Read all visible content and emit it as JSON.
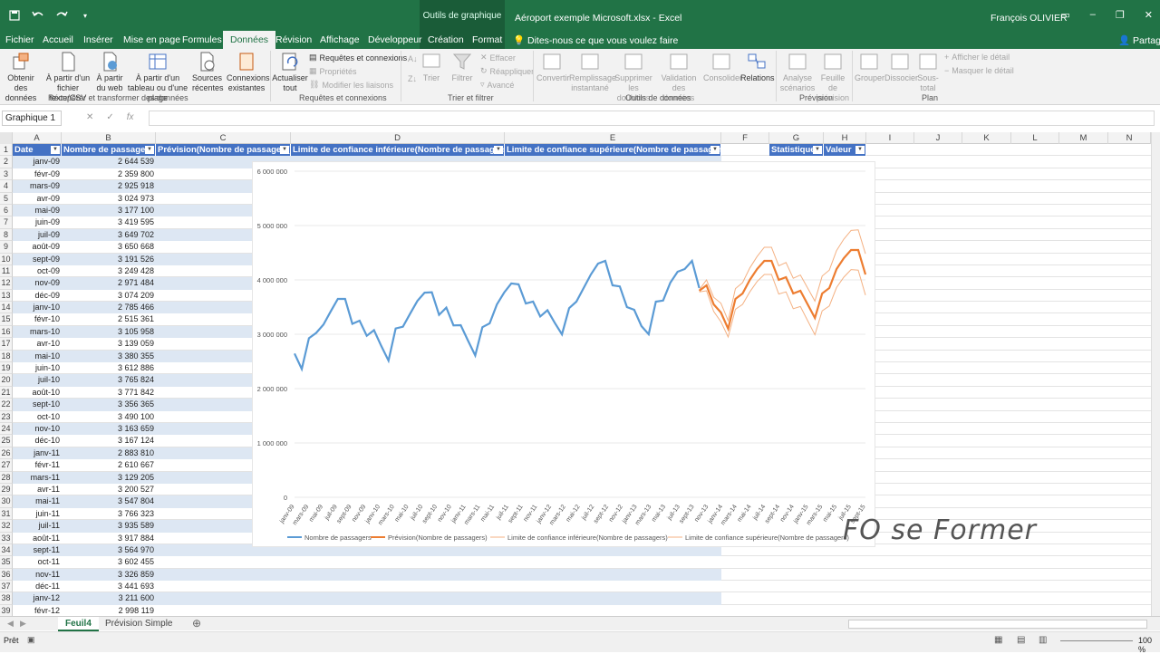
{
  "titlebar": {
    "context_tools": "Outils de graphique",
    "doc_title": "Aéroport exemple Microsoft.xlsx - Excel",
    "user": "François OLIVIER"
  },
  "tabs": [
    {
      "id": "fichier",
      "label": "Fichier"
    },
    {
      "id": "accueil",
      "label": "Accueil"
    },
    {
      "id": "inserer",
      "label": "Insérer"
    },
    {
      "id": "mise-en-page",
      "label": "Mise en page"
    },
    {
      "id": "formules",
      "label": "Formules"
    },
    {
      "id": "donnees",
      "label": "Données"
    },
    {
      "id": "revision",
      "label": "Révision"
    },
    {
      "id": "affichage",
      "label": "Affichage"
    },
    {
      "id": "developpeur",
      "label": "Développeur"
    },
    {
      "id": "creation",
      "label": "Création"
    },
    {
      "id": "format",
      "label": "Format"
    }
  ],
  "tellme": "Dites-nous ce que vous voulez faire",
  "share": "Partager",
  "ribbon": {
    "obtenir": "Obtenir des données",
    "texte_csv": "À partir d'un fichier texte/CSV",
    "web": "À partir du web",
    "tableau": "À partir d'un tableau ou d'une plage",
    "sources": "Sources récentes",
    "connexions": "Connexions existantes",
    "group_recuperer": "Récupérer et transformer des données",
    "actualiser": "Actualiser tout",
    "req_conn": "Requêtes et connexions",
    "proprietes": "Propriétés",
    "modifier_liaisons": "Modifier les liaisons",
    "group_req": "Requêtes et connexions",
    "trier": "Trier",
    "filtrer": "Filtrer",
    "effacer": "Effacer",
    "reappliquer": "Réappliquer",
    "avance": "Avancé",
    "group_trier": "Trier et filtrer",
    "convertir": "Convertir",
    "remplissage": "Remplissage instantané",
    "doublons": "Supprimer les doublons",
    "validation": "Validation des données",
    "consolider": "Consolider",
    "relations": "Relations",
    "group_outils": "Outils de données",
    "analyse": "Analyse scénarios",
    "feuille_prev": "Feuille de prévision",
    "group_prev": "Prévision",
    "grouper": "Grouper",
    "dissocier": "Dissocier",
    "sous_total": "Sous-total",
    "afficher_detail": "Afficher le détail",
    "masquer_detail": "Masquer le détail",
    "group_plan": "Plan"
  },
  "formula": {
    "namebox": "Graphique 1",
    "value": ""
  },
  "columns": [
    "A",
    "B",
    "C",
    "D",
    "E",
    "F",
    "G",
    "H",
    "I",
    "J",
    "K",
    "L",
    "M",
    "N"
  ],
  "headers": {
    "A": "Date",
    "B": "Nombre de passagers",
    "C": "Prévision(Nombre de passagers)",
    "D": "Limite de confiance inférieure(Nombre de passagers)",
    "E": "Limite de confiance supérieure(Nombre de passagers)",
    "G": "Statistique",
    "H": "Valeur"
  },
  "rows": [
    [
      "janv-09",
      "2 644 539"
    ],
    [
      "févr-09",
      "2 359 800"
    ],
    [
      "mars-09",
      "2 925 918"
    ],
    [
      "avr-09",
      "3 024 973"
    ],
    [
      "mai-09",
      "3 177 100"
    ],
    [
      "juin-09",
      "3 419 595"
    ],
    [
      "juil-09",
      "3 649 702"
    ],
    [
      "août-09",
      "3 650 668"
    ],
    [
      "sept-09",
      "3 191 526"
    ],
    [
      "oct-09",
      "3 249 428"
    ],
    [
      "nov-09",
      "2 971 484"
    ],
    [
      "déc-09",
      "3 074 209"
    ],
    [
      "janv-10",
      "2 785 466"
    ],
    [
      "févr-10",
      "2 515 361"
    ],
    [
      "mars-10",
      "3 105 958"
    ],
    [
      "avr-10",
      "3 139 059"
    ],
    [
      "mai-10",
      "3 380 355"
    ],
    [
      "juin-10",
      "3 612 886"
    ],
    [
      "juil-10",
      "3 765 824"
    ],
    [
      "août-10",
      "3 771 842"
    ],
    [
      "sept-10",
      "3 356 365"
    ],
    [
      "oct-10",
      "3 490 100"
    ],
    [
      "nov-10",
      "3 163 659"
    ],
    [
      "déc-10",
      "3 167 124"
    ],
    [
      "janv-11",
      "2 883 810"
    ],
    [
      "févr-11",
      "2 610 667"
    ],
    [
      "mars-11",
      "3 129 205"
    ],
    [
      "avr-11",
      "3 200 527"
    ],
    [
      "mai-11",
      "3 547 804"
    ],
    [
      "juin-11",
      "3 766 323"
    ],
    [
      "juil-11",
      "3 935 589"
    ],
    [
      "août-11",
      "3 917 884"
    ],
    [
      "sept-11",
      "3 564 970"
    ],
    [
      "oct-11",
      "3 602 455"
    ],
    [
      "nov-11",
      "3 326 859"
    ],
    [
      "déc-11",
      "3 441 693"
    ],
    [
      "janv-12",
      "3 211 600"
    ],
    [
      "févr-12",
      "2 998 119"
    ]
  ],
  "sheets": [
    {
      "label": "Feuil4",
      "active": true
    },
    {
      "label": "Prévision Simple",
      "active": false
    }
  ],
  "status": {
    "ready": "Prêt",
    "zoom": "100 %"
  },
  "watermark": "FO se Former",
  "chart_data": {
    "type": "line",
    "ylim": [
      0,
      6000000
    ],
    "yticks": [
      "0",
      "1 000 000",
      "2 000 000",
      "3 000 000",
      "4 000 000",
      "5 000 000",
      "6 000 000"
    ],
    "xticks": [
      "janv-09",
      "mars-09",
      "mai-09",
      "juil-09",
      "sept-09",
      "nov-09",
      "janv-10",
      "mars-10",
      "mai-10",
      "juil-10",
      "sept-10",
      "nov-10",
      "janv-11",
      "mars-11",
      "mai-11",
      "juil-11",
      "sept-11",
      "nov-11",
      "janv-12",
      "mars-12",
      "mai-12",
      "juil-12",
      "sept-12",
      "nov-12",
      "janv-13",
      "mars-13",
      "mai-13",
      "juil-13",
      "sept-13",
      "nov-13",
      "janv-14",
      "mars-14",
      "mai-14",
      "juil-14",
      "sept-14",
      "nov-14",
      "janv-15",
      "mars-15",
      "mai-15",
      "juil-15",
      "sept-15"
    ],
    "legend": [
      "Nombre de passagers",
      "Prévision(Nombre de passagers)",
      "Limite de confiance inférieure(Nombre de passagers)",
      "Limite de confiance supérieure(Nombre de passagers)"
    ],
    "colors": [
      "#5b9bd5",
      "#ed7d31",
      "#f4b183",
      "#f4b183"
    ],
    "actual": [
      2644539,
      2359800,
      2925918,
      3024973,
      3177100,
      3419595,
      3649702,
      3650668,
      3191526,
      3249428,
      2971484,
      3074209,
      2785466,
      2515361,
      3105958,
      3139059,
      3380355,
      3612886,
      3765824,
      3771842,
      3356365,
      3490100,
      3163659,
      3167124,
      2883810,
      2610667,
      3129205,
      3200527,
      3547804,
      3766323,
      3935589,
      3917884,
      3564970,
      3602455,
      3326859,
      3441693,
      3211600,
      2998119,
      3480000,
      3600000,
      3850000,
      4100000,
      4300000,
      4350000,
      3900000,
      3880000,
      3500000,
      3450000,
      3150000,
      3000000,
      3600000,
      3620000,
      3950000,
      4150000,
      4200000,
      4350000,
      3850000
    ],
    "forecast": [
      3800000,
      3900000,
      3550000,
      3400000,
      3100000,
      3650000,
      3750000,
      4000000,
      4200000,
      4350000,
      4350000,
      4000000,
      4050000,
      3750000,
      3800000,
      3550000,
      3300000,
      3750000,
      3850000,
      4200000,
      4400000,
      4550000,
      4550000,
      4100000
    ],
    "lower": [
      3780000,
      3800000,
      3420000,
      3230000,
      2950000,
      3460000,
      3550000,
      3780000,
      3970000,
      4100000,
      4100000,
      3740000,
      3780000,
      3470000,
      3510000,
      3250000,
      2990000,
      3430000,
      3520000,
      3860000,
      4050000,
      4190000,
      4180000,
      3720000
    ],
    "upper": [
      3820000,
      4000000,
      3680000,
      3570000,
      3250000,
      3840000,
      3950000,
      4220000,
      4430000,
      4600000,
      4600000,
      4260000,
      4320000,
      4030000,
      4090000,
      3850000,
      3610000,
      4070000,
      4180000,
      4540000,
      4750000,
      4910000,
      4920000,
      4480000
    ],
    "forecast_start_index": 56
  }
}
